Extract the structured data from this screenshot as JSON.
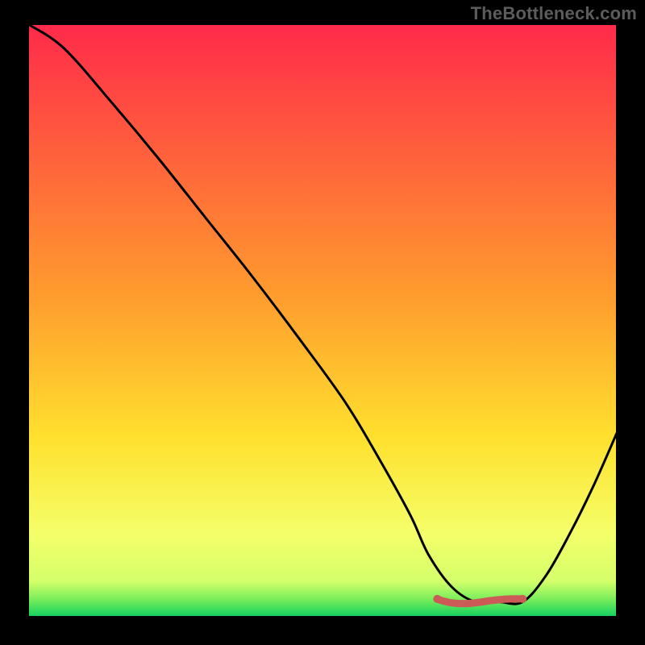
{
  "watermark": "TheBottleneck.com",
  "colors": {
    "background": "#000000",
    "gradient_top": "#ff2a4a",
    "gradient_mid": "#ffcf2a",
    "gradient_low": "#f6ff6a",
    "gradient_bottom": "#10d060",
    "curve": "#000000",
    "marker": "#cc5a56"
  },
  "chart_data": {
    "type": "line",
    "title": "",
    "xlabel": "",
    "ylabel": "",
    "xlim": [
      0,
      100
    ],
    "ylim": [
      0,
      100
    ],
    "series": [
      {
        "name": "bottleneck-curve",
        "x": [
          0,
          6,
          14,
          22,
          30,
          38,
          46,
          54,
          60,
          65,
          68,
          72,
          76,
          80,
          84,
          88,
          92,
          96,
          100
        ],
        "values": [
          100,
          96,
          87,
          77.5,
          67.5,
          57.5,
          47,
          36,
          26,
          17,
          10.5,
          5,
          2.5,
          2.5,
          2.5,
          7,
          14,
          22,
          31
        ]
      }
    ],
    "annotations": [
      {
        "name": "optimal-range-marker",
        "x_start": 69.5,
        "x_end": 84,
        "y": 2.6
      }
    ]
  }
}
